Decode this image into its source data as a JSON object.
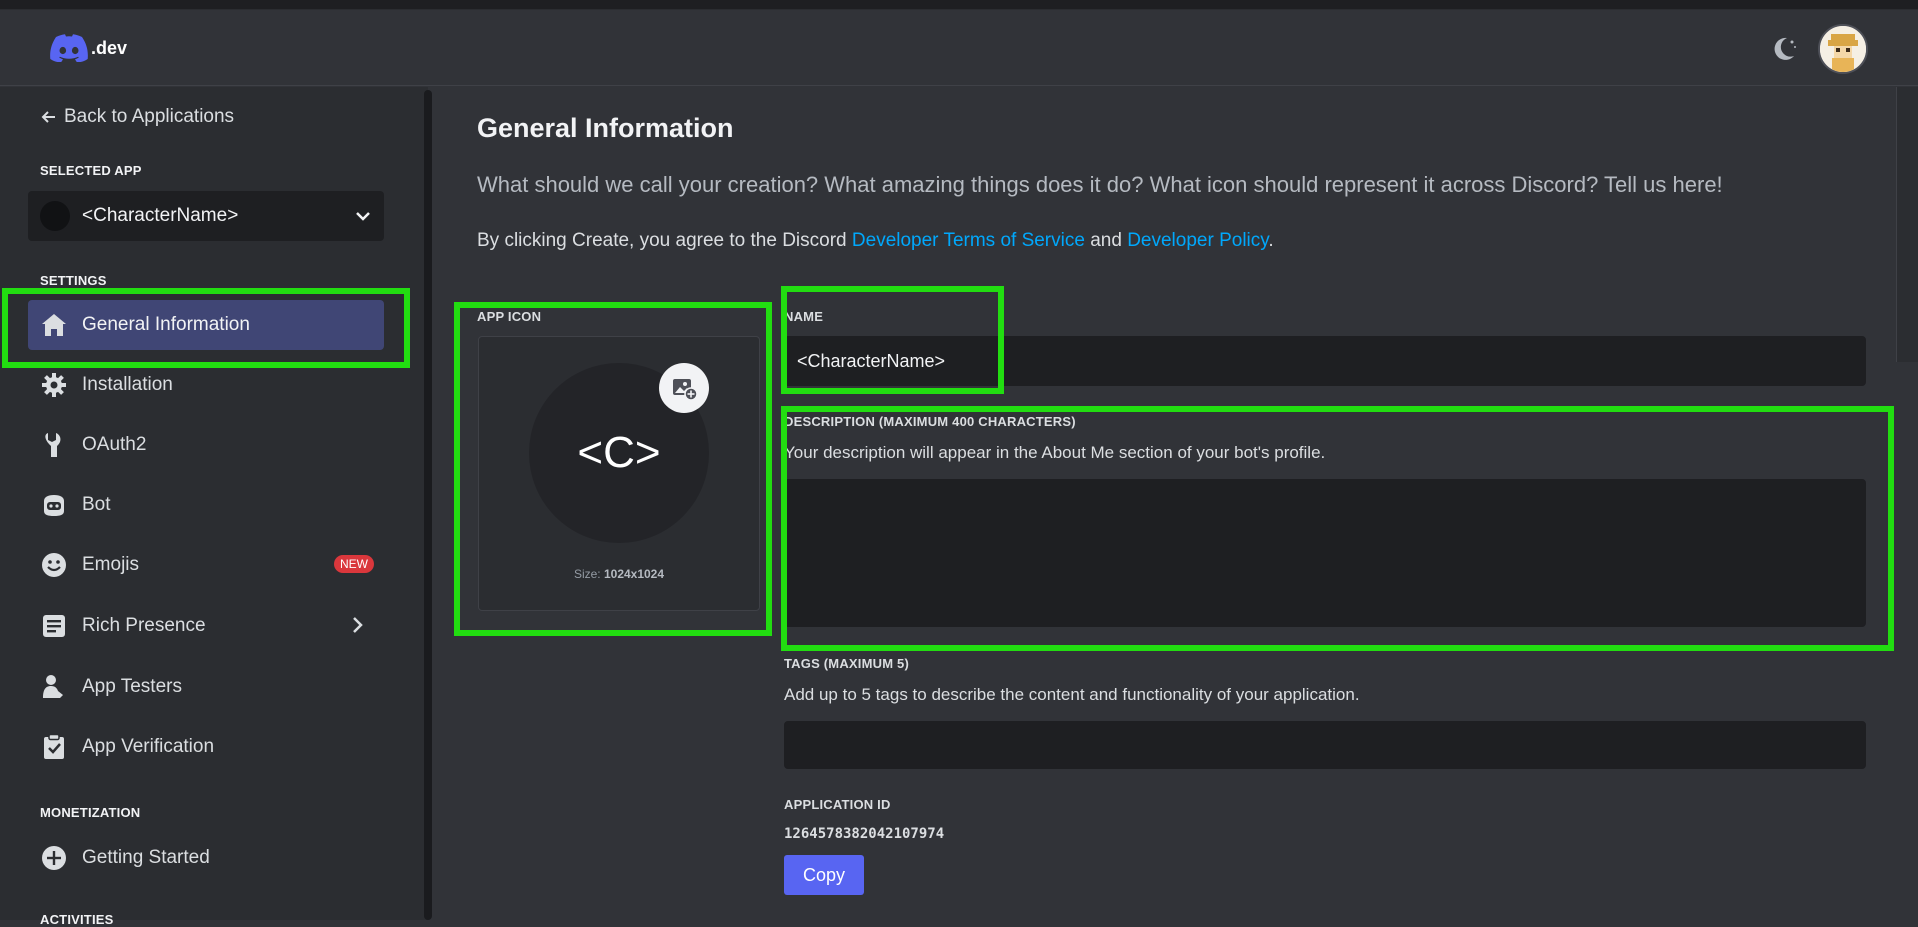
{
  "header": {
    "logo_text": ".dev",
    "theme_icon": "moon-icon",
    "avatar_icon": "user-avatar"
  },
  "sidebar": {
    "back_label": "Back to Applications",
    "selected_app_label": "SELECTED APP",
    "selected_app_name": "<CharacterName>",
    "settings_label": "SETTINGS",
    "items": [
      {
        "label": "General Information",
        "icon": "home-icon",
        "active": true
      },
      {
        "label": "Installation",
        "icon": "gear-icon"
      },
      {
        "label": "OAuth2",
        "icon": "wrench-icon"
      },
      {
        "label": "Bot",
        "icon": "bot-icon"
      },
      {
        "label": "Emojis",
        "icon": "smile-icon",
        "badge": "NEW"
      },
      {
        "label": "Rich Presence",
        "icon": "document-icon"
      },
      {
        "label": "App Testers",
        "icon": "person-icon"
      },
      {
        "label": "App Verification",
        "icon": "clipboard-check-icon"
      }
    ],
    "monetization_label": "MONETIZATION",
    "monetization_items": [
      {
        "label": "Getting Started",
        "icon": "plus-circle-icon"
      }
    ],
    "activities_label": "ACTIVITIES"
  },
  "main": {
    "title": "General Information",
    "subtitle": "What should we call your creation? What amazing things does it do? What icon should represent it across Discord? Tell us here!",
    "terms_prefix": "By clicking Create, you agree to the Discord ",
    "terms_link1": "Developer Terms of Service",
    "terms_mid": " and ",
    "terms_link2": "Developer Policy",
    "terms_suffix": ".",
    "app_icon_label": "APP ICON",
    "app_icon_text": "<C>",
    "icon_size_prefix": "Size: ",
    "icon_size_value": "1024x1024",
    "name_label": "NAME",
    "name_value": "<CharacterName>",
    "description_label": "DESCRIPTION (MAXIMUM 400 CHARACTERS)",
    "description_help": "Your description will appear in the About Me section of your bot's profile.",
    "description_value": "",
    "tags_label": "TAGS (MAXIMUM 5)",
    "tags_help": "Add up to 5 tags to describe the content and functionality of your application.",
    "tags_value": "",
    "app_id_label": "APPLICATION ID",
    "app_id_value": "1264578382042107974",
    "copy_label": "Copy"
  },
  "colors": {
    "accent": "#5865f2",
    "link": "#00a8fc",
    "highlight": "#22dd11",
    "badge": "#da373c"
  }
}
